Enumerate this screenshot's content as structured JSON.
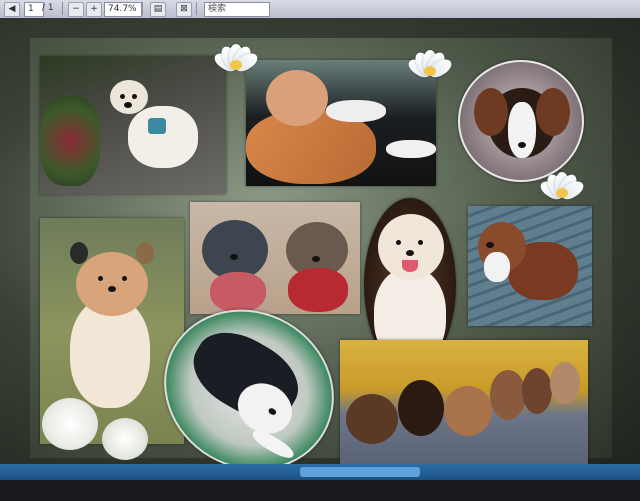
{
  "toolbar": {
    "page_number": "1",
    "page_total": "/ 1",
    "zoom": "74.7%",
    "search_placeholder": "検索"
  },
  "colors": {
    "toolbar_bg": "#c8ccd8",
    "collage_bg": "#5a6652",
    "taskbar": "#1b4f82"
  },
  "collage": {
    "photos": [
      {
        "subject": "white fluffy dog standing on stone path near flowers"
      },
      {
        "subject": "orange tabby cat sleeping on dark blanket"
      },
      {
        "subject": "brown and white dog face in circle"
      },
      {
        "subject": "fluffy tan dog on grass"
      },
      {
        "subject": "two small dogs wearing red vests"
      },
      {
        "subject": "white curly dog with open mouth in oval"
      },
      {
        "subject": "brown spaniel dog on wooden deck"
      },
      {
        "subject": "black and white dog lying on green mat in oval"
      },
      {
        "subject": "row of small dogs in front of yellow flowers"
      }
    ],
    "decorations": [
      "lotus-flower",
      "lotus-flower",
      "lotus-flower",
      "white-rose"
    ]
  }
}
